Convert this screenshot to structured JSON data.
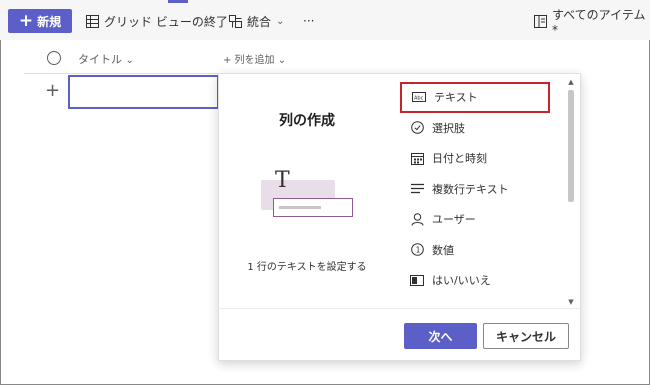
{
  "toolbar": {
    "new_label": "新規",
    "grid_exit_label": "グリッド ビューの終了",
    "integrate_label": "統合",
    "more_label": "···",
    "view_label": "すべてのアイテム*"
  },
  "list": {
    "title_column": "タイトル",
    "add_column": "+ 列を追加"
  },
  "panel": {
    "title": "列の作成",
    "preview_description": "1 行のテキストを設定する",
    "options": [
      {
        "label": "テキスト",
        "icon": "text-field-icon",
        "selected": true
      },
      {
        "label": "選択肢",
        "icon": "choice-check-icon",
        "selected": false
      },
      {
        "label": "日付と時刻",
        "icon": "calendar-icon",
        "selected": false
      },
      {
        "label": "複数行テキスト",
        "icon": "multiline-text-icon",
        "selected": false
      },
      {
        "label": "ユーザー",
        "icon": "person-icon",
        "selected": false
      },
      {
        "label": "数値",
        "icon": "number-icon",
        "selected": false
      },
      {
        "label": "はい/いいえ",
        "icon": "yes-no-toggle-icon",
        "selected": false
      }
    ],
    "next_label": "次へ",
    "cancel_label": "キャンセル"
  },
  "colors": {
    "accent": "#5b5fc7",
    "selection_outline": "#c4242b"
  }
}
